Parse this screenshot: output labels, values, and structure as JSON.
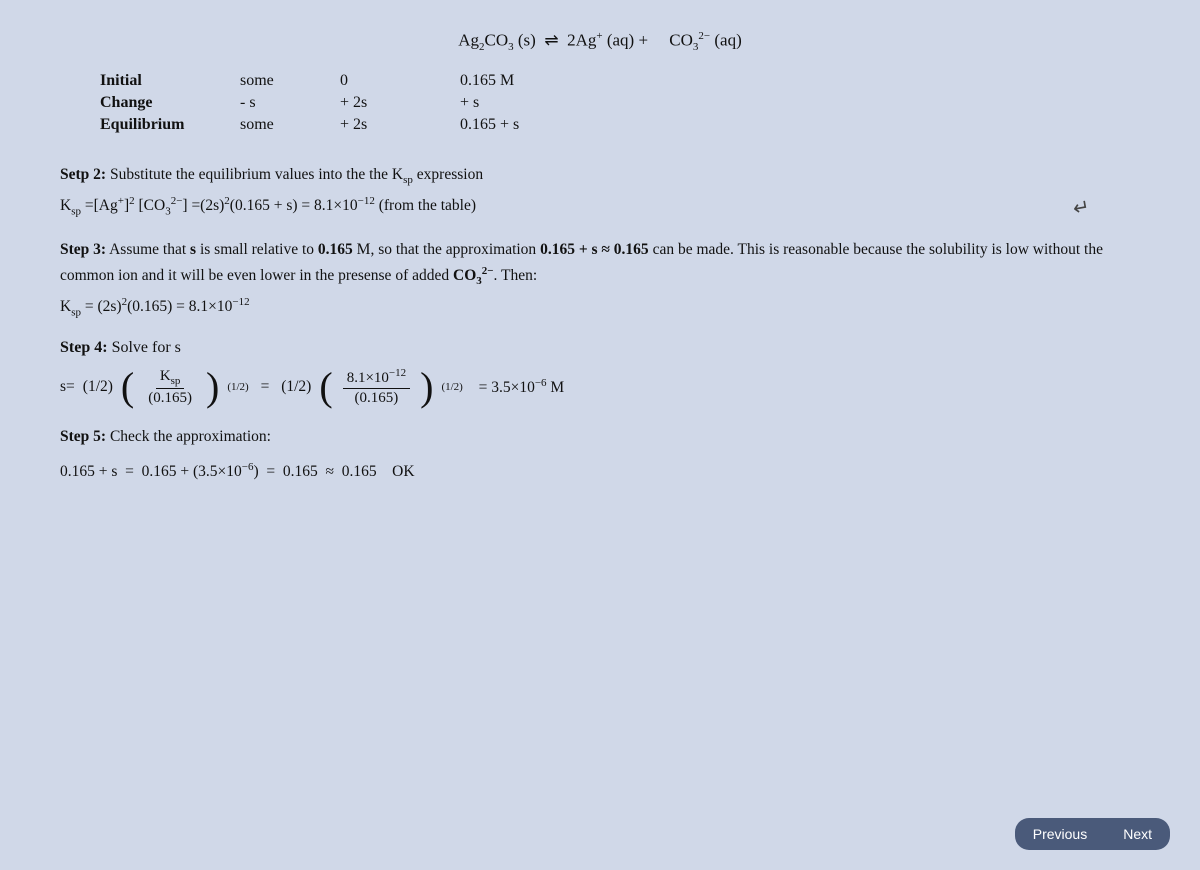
{
  "reaction": {
    "line": "Ag₂CO₃ (s) ⇌ 2Ag⁺ (aq) + CO₃²⁻ (aq)"
  },
  "table": {
    "headers": [
      "",
      "Ag₂CO₃ (s)",
      "2Ag⁺ (aq)",
      "CO₃²⁻ (aq)"
    ],
    "rows": [
      {
        "label": "Initial",
        "col1": "some",
        "col2": "0",
        "col3": "0.165 M"
      },
      {
        "label": "Change",
        "col1": "- s",
        "col2": "+ 2s",
        "col3": "+ s"
      },
      {
        "label": "Equilibrium",
        "col1": "some",
        "col2": "+ 2s",
        "col3": "0.165 + s"
      }
    ]
  },
  "step2": {
    "title": "Setp 2:",
    "text": "Substitute the equilibrium values into the the K",
    "subscript": "sp",
    "text2": "expression",
    "formula": "K_sp = [Ag⁺]² [CO₃²⁻] = (2s)²(0.165 + s) = 8.1×10⁻¹² (from the table)"
  },
  "step3": {
    "title": "Step 3:",
    "text1": "Assume that s is small relative to 0.165 M, so that the approximation 0.165 + s ≈ 0.165 can be made. This is reasonable because the solubility is low without the common ion and it will be even lower in the presense of added CO₃²⁻. Then:",
    "formula": "K_sp = (2s)²(0.165) = 8.1×10⁻¹²"
  },
  "step4": {
    "title": "Step 4:",
    "text": "Solve for s",
    "equation_parts": {
      "prefix": "s =",
      "coeff1": "(1/2)",
      "frac_num": "K_sp",
      "frac_den": "(0.165)",
      "exp1": "(1/2)",
      "equals": "=",
      "coeff2": "(1/2)",
      "frac_num2": "8.1×10⁻¹²",
      "frac_den2": "(0.165)",
      "exp2": "(1/2)",
      "result": "= 3.5×10⁻⁶ M"
    }
  },
  "step5": {
    "title": "Step 5:",
    "text": "Check the approximation:",
    "formula": "0.165 + s = 0.165 + (3.5×10⁻⁶) = 0.165 ≈ 0.165   OK"
  },
  "nav": {
    "prev_label": "Previous",
    "next_label": "Next"
  }
}
